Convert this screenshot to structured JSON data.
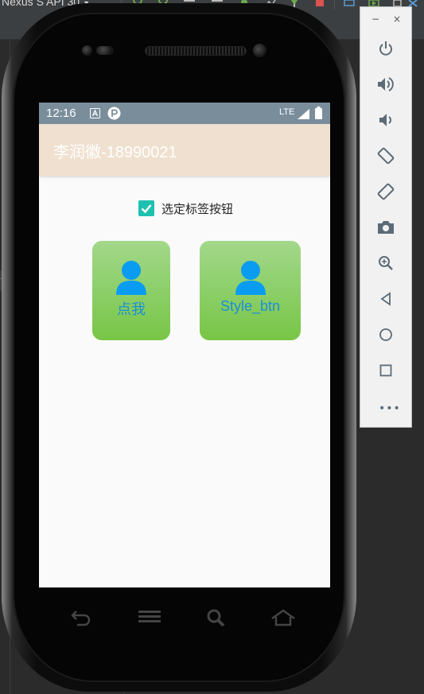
{
  "ide": {
    "device_name": "Nexus S API 30",
    "dropdown_glyph": "▼",
    "side_tab_text": "te"
  },
  "status_bar": {
    "time": "12:16",
    "network": "LTE",
    "icons": [
      "a-notification-icon",
      "p-notification-icon",
      "signal-icon",
      "battery-icon"
    ]
  },
  "app_bar": {
    "title": "李润徽-18990021"
  },
  "checkbox": {
    "label": "选定标签按钮",
    "checked": true
  },
  "buttons": [
    {
      "label": "点我",
      "icon": "person-icon"
    },
    {
      "label": "Style_btn",
      "icon": "person-icon"
    }
  ],
  "emulator_panel": {
    "minimize_glyph": "−",
    "close_glyph": "×",
    "more_glyph": "•••",
    "controls": [
      "power",
      "volume-up",
      "volume-down",
      "rotate-left",
      "rotate-right",
      "screenshot",
      "zoom",
      "back",
      "home",
      "overview"
    ]
  },
  "colors": {
    "status_bar": "#7a8d9b",
    "app_bar": "#f0e0cf",
    "checkbox": "#1ec0b0",
    "button_gradient_top": "#a3d88a",
    "button_gradient_bottom": "#78c545",
    "button_text": "#1a8ed8",
    "icon_blue": "#0a9cf0"
  }
}
